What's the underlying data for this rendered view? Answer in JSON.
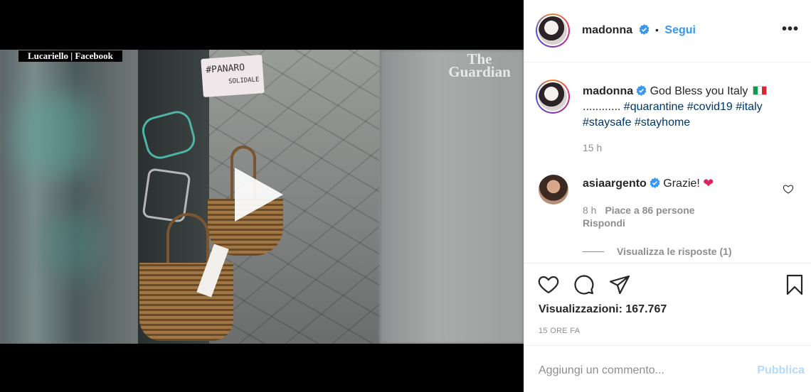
{
  "media": {
    "credit": "Lucariello | Facebook",
    "watermark_line1": "The",
    "watermark_line2": "Guardian",
    "sign_line1": "#PANARO",
    "sign_line2": "SOLIDALE"
  },
  "post": {
    "author": "madonna",
    "follow_label": "Segui",
    "more_label": "•••",
    "caption_text": "God Bless you Italy",
    "caption_dots": "............",
    "hashtags": [
      "#quarantine",
      "#covid19",
      "#italy",
      "#staysafe",
      "#stayhome"
    ],
    "caption_time": "15 h",
    "views_label": "Visualizzazioni: 167.767",
    "time_ago": "15 ORE FA"
  },
  "comment": {
    "author": "asiaargento",
    "text": "Grazie!",
    "time": "8 h",
    "likes": "Piace a 86 persone",
    "reply_label": "Rispondi",
    "view_replies": "Visualizza le risposte (1)"
  },
  "composer": {
    "placeholder": "Aggiungi un commento...",
    "publish_label": "Pubblica"
  },
  "colors": {
    "link_blue": "#3897f0",
    "hashtag": "#00376b",
    "muted": "#8e8e8e",
    "publish_disabled": "#b3dbff"
  }
}
